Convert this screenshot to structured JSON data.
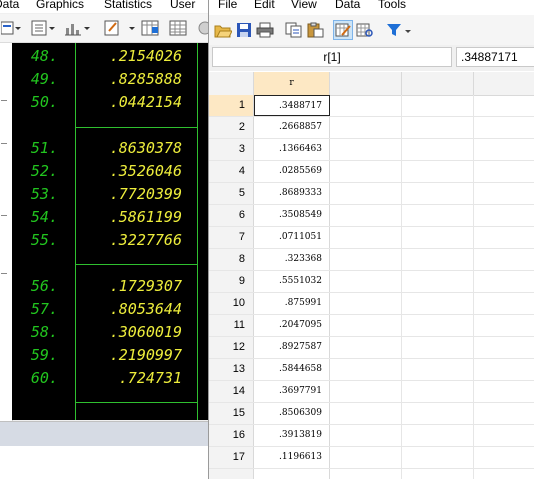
{
  "stata_main": {
    "menu": [
      "Data",
      "Graphics",
      "Statistics",
      "User"
    ],
    "results": {
      "blocks": [
        {
          "rows": [
            {
              "obs": "48.",
              "value": ".2154026"
            },
            {
              "obs": "49.",
              "value": ".8285888"
            },
            {
              "obs": "50.",
              "value": ".0442154"
            }
          ]
        },
        {
          "rows": [
            {
              "obs": "51.",
              "value": ".8630378"
            },
            {
              "obs": "52.",
              "value": ".3526046"
            },
            {
              "obs": "53.",
              "value": ".7720399"
            },
            {
              "obs": "54.",
              "value": ".5861199"
            },
            {
              "obs": "55.",
              "value": ".3227766"
            }
          ]
        },
        {
          "rows": [
            {
              "obs": "56.",
              "value": ".1729307"
            },
            {
              "obs": "57.",
              "value": ".8053644"
            },
            {
              "obs": "58.",
              "value": ".3060019"
            },
            {
              "obs": "59.",
              "value": ".2190997"
            },
            {
              "obs": "60.",
              "value": ".724731"
            }
          ]
        }
      ],
      "colors": {
        "background": "#000000",
        "obs_number": "#22c51f",
        "value": "#eded3c",
        "rule": "#2fbf2f"
      }
    }
  },
  "data_editor": {
    "menu": [
      "File",
      "Edit",
      "View",
      "Data",
      "Tools"
    ],
    "toolbar_icons": [
      "open-icon",
      "save-icon",
      "print-icon",
      "copy-icon",
      "paste-icon",
      "edit-mode-icon",
      "browse-mode-icon",
      "filter-icon",
      "dropdown-arrow-icon"
    ],
    "cell_reference": "r[1]",
    "cell_value": ".34887171",
    "column_header": "r",
    "selected_row": 1,
    "rows": [
      {
        "n": "1",
        "r": ".3488717"
      },
      {
        "n": "2",
        "r": ".2668857"
      },
      {
        "n": "3",
        "r": ".1366463"
      },
      {
        "n": "4",
        "r": ".0285569"
      },
      {
        "n": "5",
        "r": ".8689333"
      },
      {
        "n": "6",
        "r": ".3508549"
      },
      {
        "n": "7",
        "r": ".0711051"
      },
      {
        "n": "8",
        "r": ".323368"
      },
      {
        "n": "9",
        "r": ".5551032"
      },
      {
        "n": "10",
        "r": ".875991"
      },
      {
        "n": "11",
        "r": ".2047095"
      },
      {
        "n": "12",
        "r": ".8927587"
      },
      {
        "n": "13",
        "r": ".5844658"
      },
      {
        "n": "14",
        "r": ".3697791"
      },
      {
        "n": "15",
        "r": ".8506309"
      },
      {
        "n": "16",
        "r": ".3913819"
      },
      {
        "n": "17",
        "r": ".1196613"
      }
    ],
    "colors": {
      "header_selected": "#fde8c4",
      "filter_icon": "#1e6fd6",
      "active_tool": "#cce4f7"
    }
  }
}
